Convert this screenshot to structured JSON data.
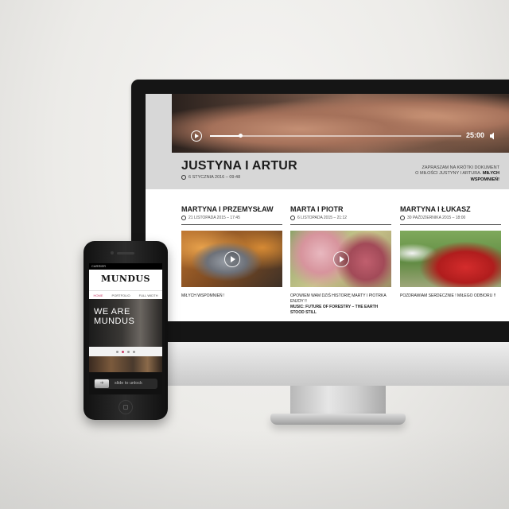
{
  "desktop": {
    "player": {
      "time": "25:00",
      "progress": 0.12
    },
    "featured_post": {
      "title": "JUSTYNA I ARTUR",
      "date": "6 STYCZNIA 2016 – 09:48",
      "intro_line1": "ZAPRASZAM NA KRÓTKI DOKUMENT",
      "intro_line2": "O MIŁOŚCI JUSTYNY I ARTURA.",
      "intro_bold": "MIŁYCH WSPOMNIEŃ!"
    },
    "posts": [
      {
        "title": "MARTYNA I PRZEMYSŁAW",
        "date": "21 LISTOPADA 2015 – 17:45",
        "text": "MIŁYCH WSPOMNIEŃ !",
        "text_bold": ""
      },
      {
        "title": "MARTA I PIOTR",
        "date": "6 LISTOPADA 2015 – 21:12",
        "text": "OPOWIEM WAM DZIŚ HISTORIĘ MARTY I PIOTRKA",
        "text2": "ENJOY !!",
        "text_bold": "MUSIC: FUTURE OF FORESTRY – THE EARTH STOOD STILL"
      },
      {
        "title": "MARTYNA I ŁUKASZ",
        "date": "30 PAŹDZIERNIKA 2015 – 18:00",
        "text": "POZDRAWIAM SERDECZNIE ! MIŁEGO ODBIORU !!",
        "text_bold": ""
      }
    ]
  },
  "phone": {
    "carrier": "CARRIER",
    "logo": "MUNDUS",
    "nav": [
      "HOME",
      "PORTFOLIO",
      "FULL WIDTH"
    ],
    "hero_line1": "WE ARE",
    "hero_line2": "MUNDUS",
    "slide_text": "slide to unlock"
  },
  "colors": {
    "accent": "#c9406a",
    "monitor_bezel": "#151515"
  }
}
